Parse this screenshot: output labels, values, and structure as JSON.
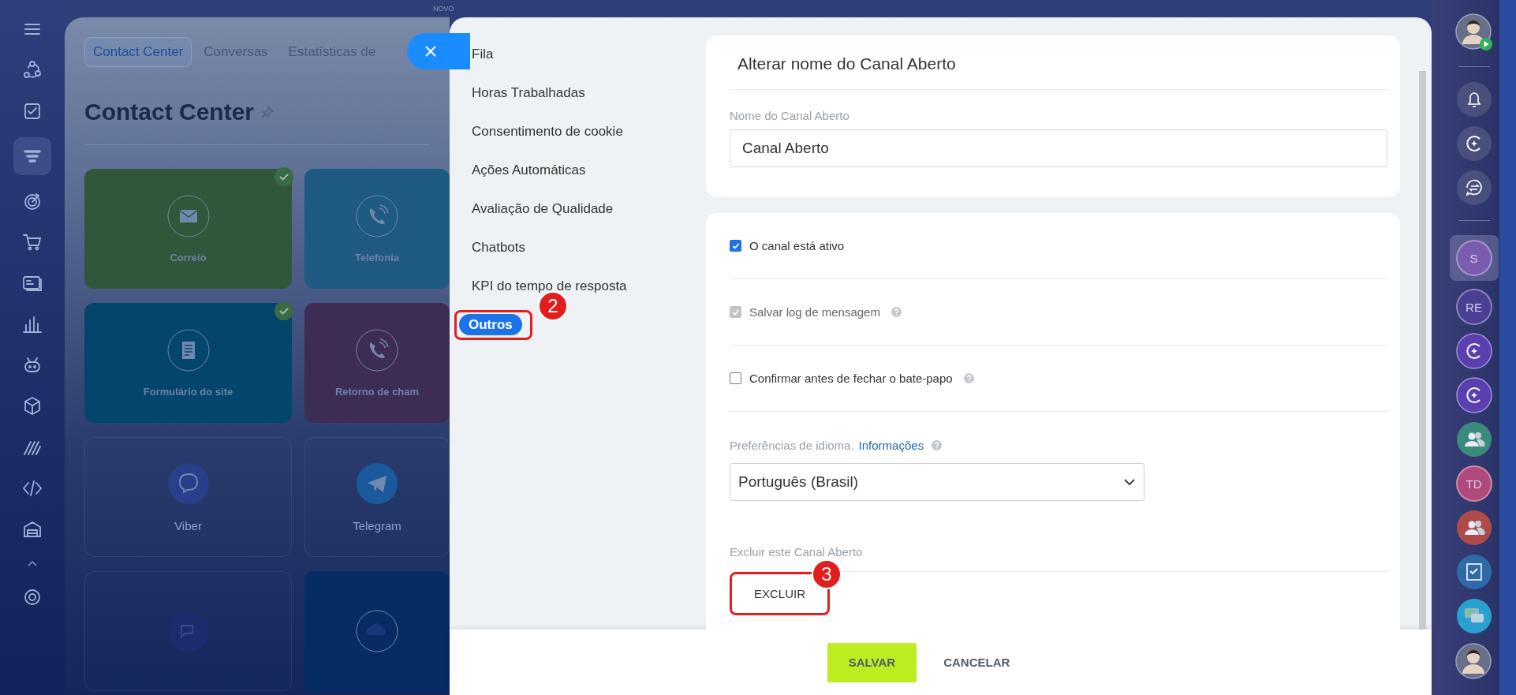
{
  "left_nav": {
    "items": [
      {
        "kind": "menu",
        "selected": false
      },
      {
        "kind": "flow",
        "selected": false
      },
      {
        "kind": "tasks",
        "selected": false
      },
      {
        "kind": "funnel",
        "selected": true
      },
      {
        "kind": "target",
        "selected": false
      },
      {
        "kind": "cart",
        "selected": false
      },
      {
        "kind": "card",
        "selected": false
      },
      {
        "kind": "chart",
        "selected": false
      },
      {
        "kind": "robot",
        "selected": false
      },
      {
        "kind": "box",
        "selected": false
      },
      {
        "kind": "stripes",
        "selected": false
      },
      {
        "kind": "code",
        "selected": false
      },
      {
        "kind": "store",
        "selected": false
      },
      {
        "kind": "caret",
        "selected": false
      },
      {
        "kind": "gear",
        "selected": false
      }
    ]
  },
  "background_page": {
    "badge": "NOVO",
    "tabs": [
      {
        "label": "Contact Center",
        "selected": true
      },
      {
        "label": "Conversas",
        "selected": false
      },
      {
        "label": "Estatísticas de",
        "selected": false
      }
    ],
    "title": "Contact Center",
    "tiles": [
      {
        "label": "Correio",
        "kind": "filled",
        "color": "#31573a",
        "connected": true
      },
      {
        "label": "Telefonia",
        "kind": "filled",
        "color": "#1e5a82",
        "connected": false
      },
      {
        "label": "Formulário do site",
        "kind": "filled",
        "color": "#04466b",
        "connected": true
      },
      {
        "label": "Retorno de cham",
        "kind": "filled",
        "color": "#3d2d55",
        "connected": false
      },
      {
        "label": "Viber",
        "kind": "outline",
        "color": "#2a3f8a",
        "connected": false
      },
      {
        "label": "Telegram",
        "kind": "outline",
        "color": "#1a5a9c",
        "connected": false
      },
      {
        "kind": "outline",
        "color": "#1c2a6e",
        "connected": false
      },
      {
        "kind": "filled",
        "color": "#062c66",
        "connected": false
      }
    ]
  },
  "modal": {
    "menu": [
      {
        "label": "Fila",
        "selected": false
      },
      {
        "label": "Horas Trabalhadas",
        "selected": false
      },
      {
        "label": "Consentimento de cookie",
        "selected": false
      },
      {
        "label": "Ações Automáticas",
        "selected": false
      },
      {
        "label": "Avaliação de Qualidade",
        "selected": false
      },
      {
        "label": "Chatbots",
        "selected": false
      },
      {
        "label": "KPI do tempo de resposta",
        "selected": false
      },
      {
        "label": "Outros",
        "selected": true,
        "callout": "2"
      }
    ],
    "rename": {
      "title": "Alterar nome do Canal Aberto",
      "field_label": "Nome do Canal Aberto",
      "value": "Canal Aberto"
    },
    "options": [
      {
        "label": "O canal está ativo",
        "checked": true,
        "disabled": false,
        "help": false
      },
      {
        "label": "Salvar log de mensagem",
        "checked": true,
        "disabled": true,
        "help": true
      },
      {
        "label": "Confirmar antes de fechar o bate-papo",
        "checked": false,
        "disabled": false,
        "help": true
      }
    ],
    "language": {
      "label": "Preferências de idioma.",
      "link": "Informações",
      "help": true,
      "value": "Português (Brasil)"
    },
    "delete": {
      "heading": "Excluir este Canal Aberto",
      "button": "EXCLUIR",
      "callout": "3"
    },
    "footer": {
      "save": "SALVAR",
      "cancel": "CANCELAR"
    }
  },
  "right_bar": {
    "items": [
      {
        "kind": "photo",
        "selected": false,
        "badge": true
      },
      {
        "kind": "divider"
      },
      {
        "kind": "bell",
        "selected": false
      },
      {
        "kind": "copilot",
        "selected": false
      },
      {
        "kind": "exchange",
        "selected": false
      },
      {
        "kind": "divider"
      },
      {
        "kind": "initials",
        "text": "S",
        "color": "#7b5bb0",
        "selected": true
      },
      {
        "kind": "initials",
        "text": "RE",
        "color": "#4b3f93",
        "selected": false
      },
      {
        "kind": "copilot-chat",
        "color": "#5a3fb0",
        "selected": false
      },
      {
        "kind": "copilot-chat",
        "color": "#5a3fb0",
        "selected": false
      },
      {
        "kind": "group",
        "color": "#3c8a7c",
        "selected": false
      },
      {
        "kind": "initials",
        "text": "TD",
        "color": "#b04a7a",
        "selected": false
      },
      {
        "kind": "group",
        "color": "#b04a4a",
        "selected": false
      },
      {
        "kind": "task",
        "color": "#2f6aa8",
        "selected": false
      },
      {
        "kind": "chat",
        "color": "#2aa0d0",
        "selected": false
      },
      {
        "kind": "photo",
        "selected": false,
        "badge": false
      }
    ]
  }
}
